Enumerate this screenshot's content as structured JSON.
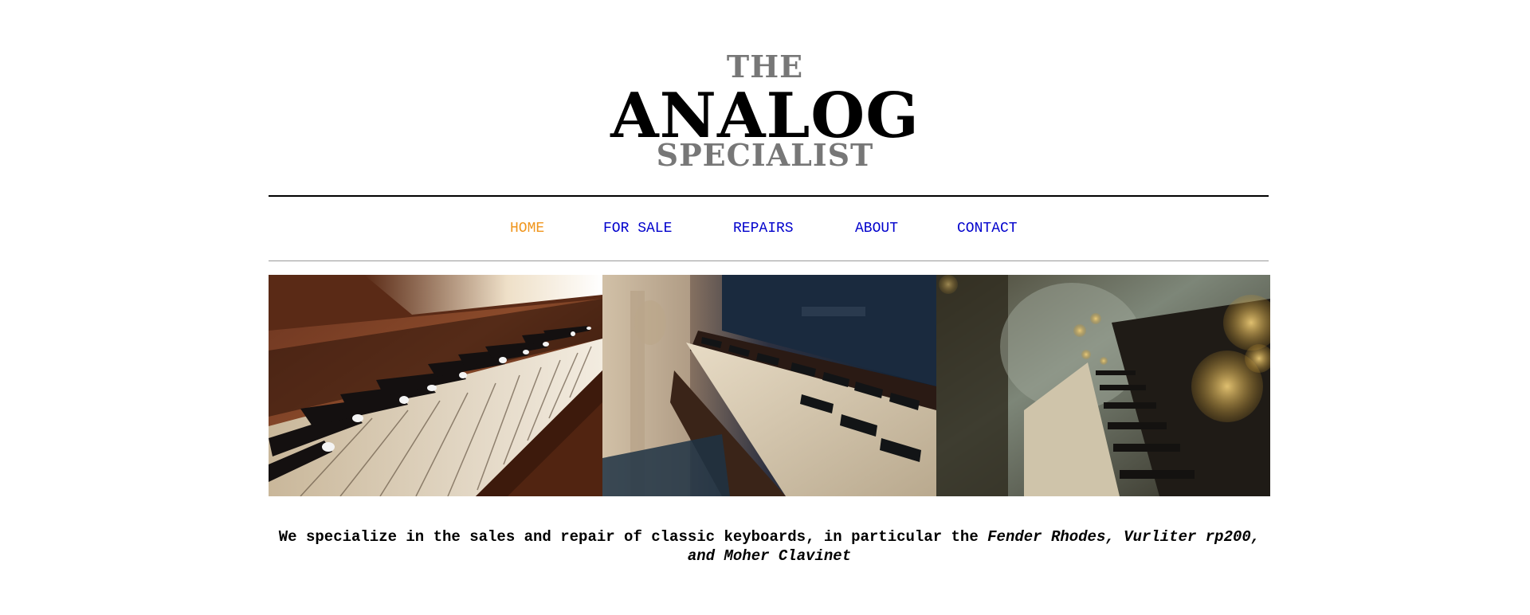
{
  "logo": {
    "line1": "THE",
    "line2": "ANALOG",
    "line3": "SPECIALIST"
  },
  "nav": {
    "items": [
      {
        "label": "HOME",
        "active": true
      },
      {
        "label": "FOR SALE",
        "active": false
      },
      {
        "label": "REPAIRS",
        "active": false
      },
      {
        "label": "ABOUT",
        "active": false
      },
      {
        "label": "CONTACT",
        "active": false
      }
    ],
    "active_color": "#f0961e",
    "link_color": "#0000cc"
  },
  "gallery": {
    "images": [
      {
        "icon": "piano-keys-photo-1"
      },
      {
        "icon": "piano-keys-photo-2"
      },
      {
        "icon": "piano-keys-photo-3"
      }
    ]
  },
  "tagline": {
    "text": "We specialize in the sales and repair of classic keyboards, in particular the ",
    "emphasis": "Fender Rhodes, Vurliter rp200, and Moher Clavinet"
  }
}
